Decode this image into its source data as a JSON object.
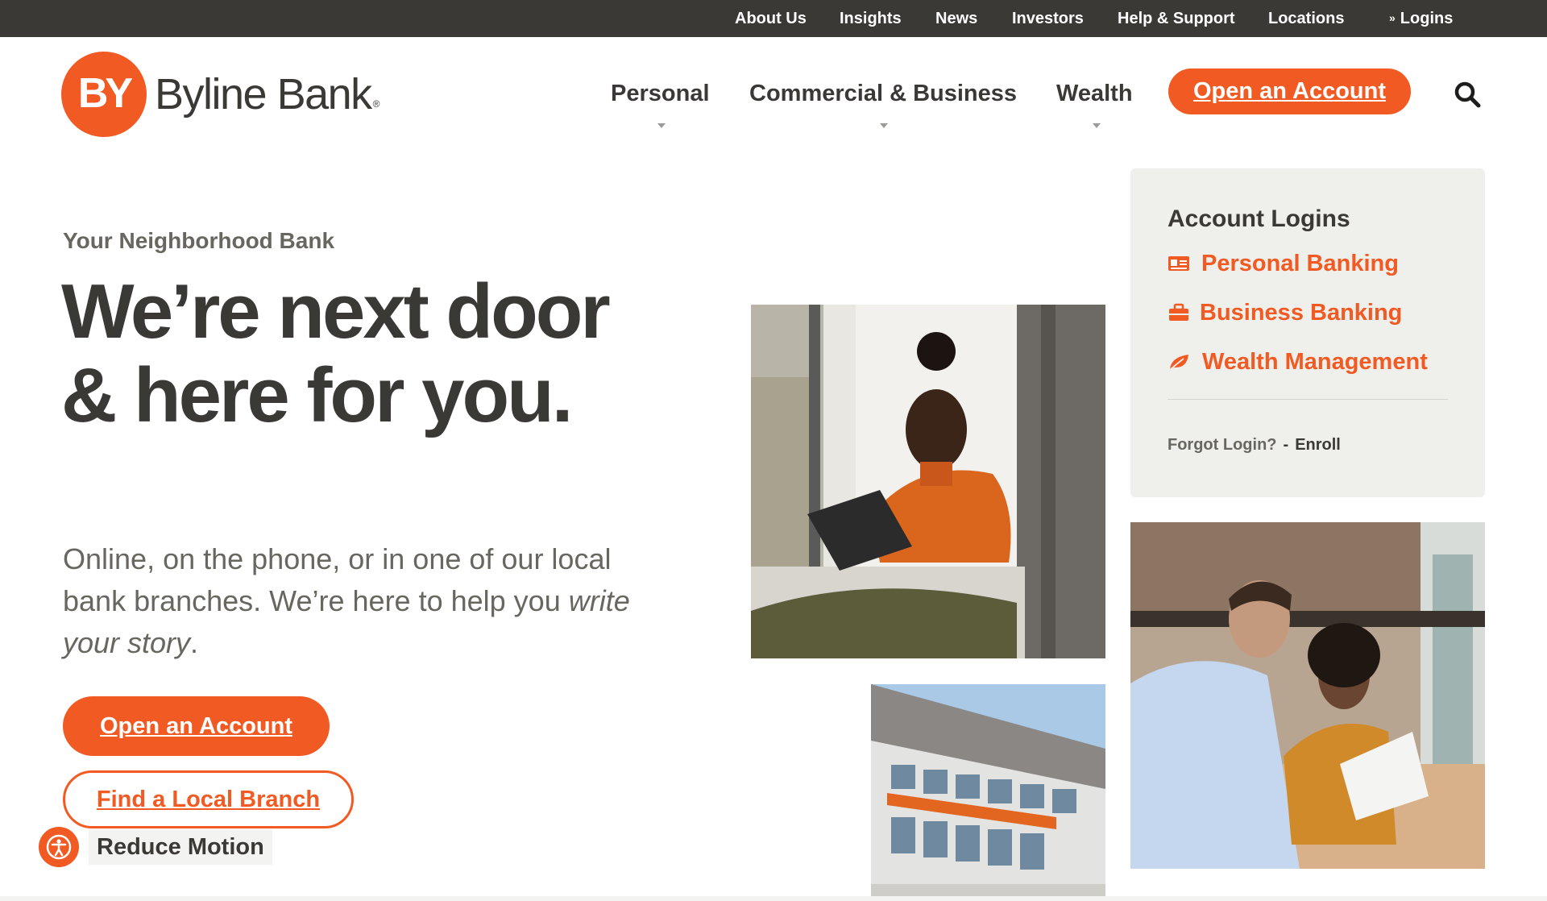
{
  "colors": {
    "brand_orange": "#f15a22",
    "charcoal": "#3a3935",
    "gray_text": "#67665f",
    "card_bg": "#efefeb"
  },
  "topbar": {
    "links": [
      "About Us",
      "Insights",
      "News",
      "Investors",
      "Help & Support",
      "Locations"
    ],
    "logins_label": "Logins",
    "logins_icon": "chevron-double-down-icon"
  },
  "header": {
    "logo_mark": "BY",
    "logo_text": "Byline Bank",
    "logo_reg": "®",
    "nav": [
      "Personal",
      "Commercial & Business",
      "Wealth"
    ],
    "open_account_label": "Open an Account",
    "search_icon": "search-icon"
  },
  "hero": {
    "eyebrow": "Your Neighborhood Bank",
    "headline": "We’re next door & here for you.",
    "subtext_main": "Online, on the phone, or in one of our local bank branches. We’re here to help you",
    "subtext_em": "write your story",
    "subtext_end": ".",
    "primary_button": "Open an Account",
    "secondary_button": "Find a Local Branch"
  },
  "accessibility": {
    "reduce_motion_label": "Reduce Motion",
    "icon": "accessibility-icon"
  },
  "login_card": {
    "title": "Account Logins",
    "links": [
      {
        "label": "Personal Banking",
        "icon": "id-card-icon"
      },
      {
        "label": "Business Banking",
        "icon": "briefcase-icon"
      },
      {
        "label": "Wealth Management",
        "icon": "leaf-icon"
      }
    ],
    "forgot_label": "Forgot Login?",
    "separator": "-",
    "enroll_label": "Enroll"
  }
}
